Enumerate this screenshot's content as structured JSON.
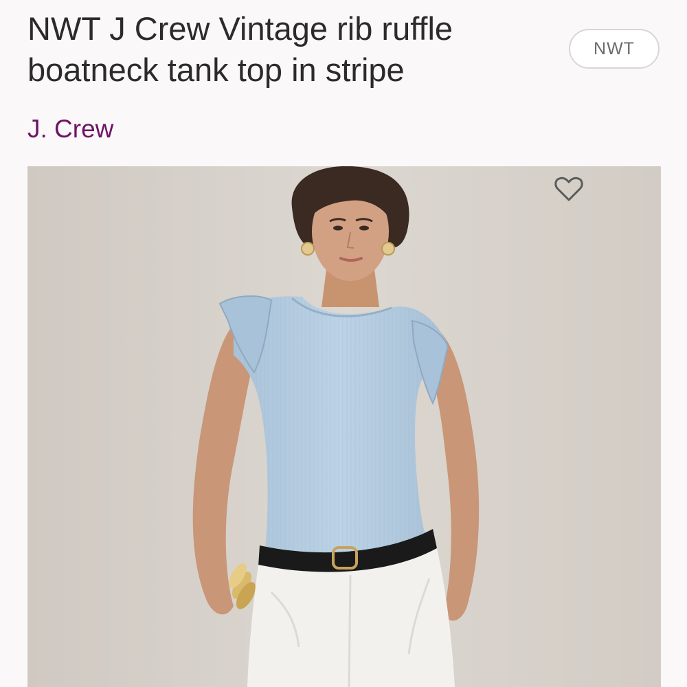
{
  "listing": {
    "title": "NWT J Crew Vintage rib ruffle boatneck tank top in stripe",
    "condition_badge": "NWT",
    "brand": "J. Crew"
  },
  "photo": {
    "subject": "model wearing light blue sleeveless ribbed tank with ruffled shoulders, black belt and white pants",
    "colors": {
      "background": "#d7d2cb",
      "top": "#b7cfe3",
      "pants": "#f2f1ee",
      "belt": "#1a1a1a",
      "skin": "#cf9c7c",
      "hair": "#3a2a22"
    }
  },
  "icons": {
    "favorite": "heart-outline-icon"
  },
  "colors": {
    "title": "#2b2b2b",
    "brand": "#6d1463",
    "badge_border": "#d8d6d6",
    "badge_text": "#6b6b6b"
  }
}
